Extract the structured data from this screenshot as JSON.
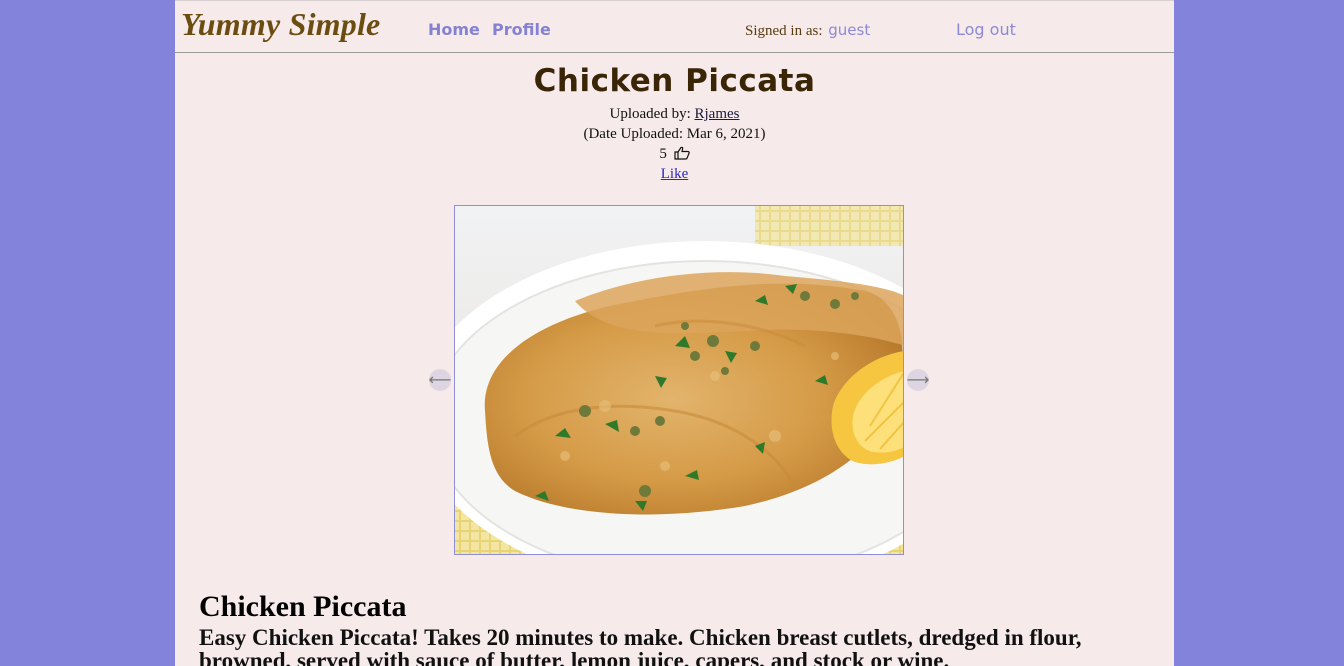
{
  "header": {
    "logo": "Yummy Simple",
    "nav": {
      "home": "Home",
      "profile": "Profile"
    },
    "signed_in_label": "Signed in as:",
    "signed_in_user": "guest",
    "logout": "Log out"
  },
  "recipe": {
    "title": "Chicken Piccata",
    "uploaded_by_label": "Uploaded by:",
    "uploader": "Rjames",
    "date_uploaded": "(Date Uploaded: Mar 6, 2021)",
    "likes": "5",
    "like_link": "Like",
    "section_title": "Chicken Piccata",
    "description": "Easy Chicken Piccata! Takes 20 minutes to make. Chicken breast cutlets, dredged in flour, browned, served with sauce of butter, lemon juice, capers, and stock or wine."
  },
  "slider": {
    "prev": "⟵",
    "next": "⟶"
  },
  "icons": {
    "like": "thumbs-up-icon",
    "prev": "arrow-left-icon",
    "next": "arrow-right-icon"
  },
  "colors": {
    "background": "#8383db",
    "page": "#f6eaea",
    "logo": "#6b4d12",
    "nav": "#8582d3",
    "title": "#3a2606"
  }
}
